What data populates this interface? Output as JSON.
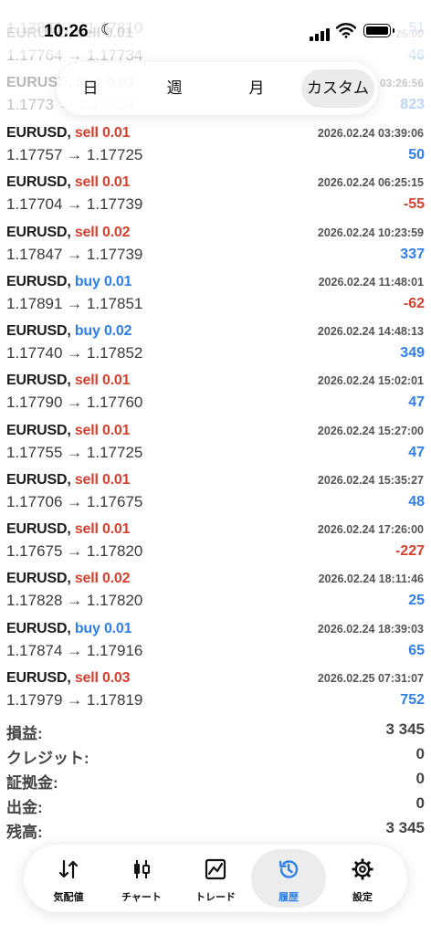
{
  "status_bar": {
    "time": "10:26"
  },
  "ghost_rows": [
    {
      "symbol": "",
      "prices": "1.17843 → 1.17810",
      "date": "",
      "pl": "51"
    },
    {
      "symbol": "EURUSD, sell 0.01",
      "prices": "1.17764 → 1.17734",
      "date": "25:00",
      "pl": "46"
    },
    {
      "symbol": "EURUSD, buy 0.03",
      "prices": "1.1773 → 1.13014",
      "date": "03:26:56",
      "pl": "823"
    }
  ],
  "period_tabs": [
    "日",
    "週",
    "月",
    "カスタム"
  ],
  "period_selected": "カスタム",
  "trades": [
    {
      "symbol": "EURUSD,",
      "side": "sell 0.01",
      "prices": "1.17757 → 1.17725",
      "date": "2026.02.24 03:39:06",
      "pl": "50"
    },
    {
      "symbol": "EURUSD,",
      "side": "sell 0.01",
      "prices": "1.17704 → 1.17739",
      "date": "2026.02.24 06:25:15",
      "pl": "-55"
    },
    {
      "symbol": "EURUSD,",
      "side": "sell 0.02",
      "prices": "1.17847 → 1.17739",
      "date": "2026.02.24 10:23:59",
      "pl": "337"
    },
    {
      "symbol": "EURUSD,",
      "side": "buy 0.01",
      "prices": "1.17891 → 1.17851",
      "date": "2026.02.24 11:48:01",
      "pl": "-62"
    },
    {
      "symbol": "EURUSD,",
      "side": "buy 0.02",
      "prices": "1.17740 → 1.17852",
      "date": "2026.02.24 14:48:13",
      "pl": "349"
    },
    {
      "symbol": "EURUSD,",
      "side": "sell 0.01",
      "prices": "1.17790 → 1.17760",
      "date": "2026.02.24 15:02:01",
      "pl": "47"
    },
    {
      "symbol": "EURUSD,",
      "side": "sell 0.01",
      "prices": "1.17755 → 1.17725",
      "date": "2026.02.24 15:27:00",
      "pl": "47"
    },
    {
      "symbol": "EURUSD,",
      "side": "sell 0.01",
      "prices": "1.17706 → 1.17675",
      "date": "2026.02.24 15:35:27",
      "pl": "48"
    },
    {
      "symbol": "EURUSD,",
      "side": "sell 0.01",
      "prices": "1.17675 → 1.17820",
      "date": "2026.02.24 17:26:00",
      "pl": "-227"
    },
    {
      "symbol": "EURUSD,",
      "side": "sell 0.02",
      "prices": "1.17828 → 1.17820",
      "date": "2026.02.24 18:11:46",
      "pl": "25"
    },
    {
      "symbol": "EURUSD,",
      "side": "buy 0.01",
      "prices": "1.17874 → 1.17916",
      "date": "2026.02.24 18:39:03",
      "pl": "65"
    },
    {
      "symbol": "EURUSD,",
      "side": "sell 0.03",
      "prices": "1.17979 → 1.17819",
      "date": "2026.02.25 07:31:07",
      "pl": "752"
    }
  ],
  "summary": [
    {
      "label": "損益:",
      "value": "3 345"
    },
    {
      "label": "クレジット:",
      "value": "0"
    },
    {
      "label": "証拠金:",
      "value": "0"
    },
    {
      "label": "出金:",
      "value": "0"
    },
    {
      "label": "残高:",
      "value": "3 345"
    }
  ],
  "bottom_tabs": [
    {
      "label": "気配値",
      "icon": "quotes-arrows-icon"
    },
    {
      "label": "チャート",
      "icon": "candlestick-icon"
    },
    {
      "label": "トレード",
      "icon": "trade-chart-icon"
    },
    {
      "label": "履歴",
      "icon": "history-clock-icon"
    },
    {
      "label": "設定",
      "icon": "gear-icon"
    }
  ],
  "active_tab": "履歴",
  "colors": {
    "sell": "#d6402e",
    "buy": "#2f7fea",
    "profit": "#2f7fea",
    "loss": "#d6402e"
  }
}
